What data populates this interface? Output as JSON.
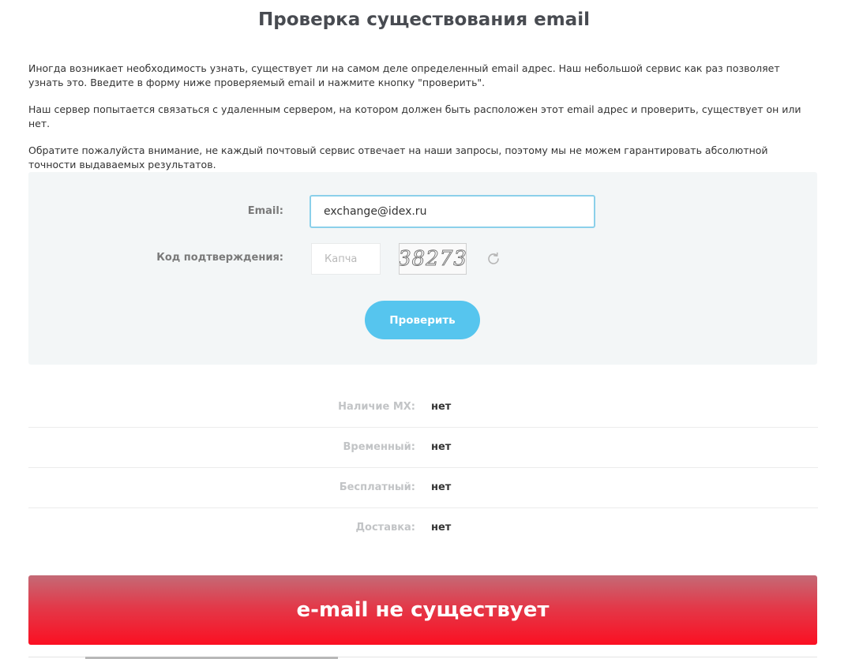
{
  "page": {
    "title": "Проверка существования email"
  },
  "intro": {
    "p1": "Иногда возникает необходимость узнать, существует ли на самом деле определенный email адрес. Наш небольшой сервис как раз позволяет узнать это. Введите в форму ниже проверяемый email и нажмите кнопку \"проверить\".",
    "p2": "Наш сервер попытается связаться с удаленным сервером, на котором должен быть расположен этот email адрес и проверить, существует он или нет.",
    "p3": "Обратите пожалуйста внимание, не каждый почтовый сервис отвечает на наши запросы, поэтому мы не можем гарантировать абсолютной точности выдаваемых результатов."
  },
  "form": {
    "email_label": "Email:",
    "email_value": "exchange@idex.ru",
    "captcha_label": "Код подтверждения:",
    "captcha_placeholder": "Капча",
    "captcha_image_text": "38273",
    "refresh_icon": "refresh-icon",
    "submit_label": "Проверить"
  },
  "results": [
    {
      "label": "Наличие MX:",
      "value": "нет"
    },
    {
      "label": "Временный:",
      "value": "нет"
    },
    {
      "label": "Бесплатный:",
      "value": "нет"
    },
    {
      "label": "Доставка:",
      "value": "нет"
    }
  ],
  "banner": {
    "text": "e-mail не существует"
  },
  "colors": {
    "accent": "#56c5ee",
    "error": "#fb0f22",
    "panel_bg": "#f3f6f7"
  }
}
